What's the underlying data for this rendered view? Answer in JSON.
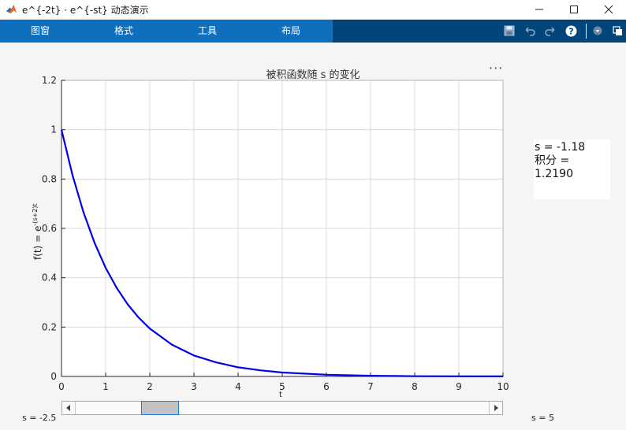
{
  "window": {
    "title": "e^{-2t} · e^{-st} 动态演示",
    "controls": [
      "minimize-icon",
      "maximize-icon",
      "close-icon"
    ]
  },
  "menu": {
    "items": [
      "图窗",
      "格式",
      "工具",
      "布局"
    ]
  },
  "toolbar": {
    "icons": [
      "save-icon",
      "undo-icon",
      "redo-icon",
      "help-icon",
      "dropdown-icon",
      "undock-icon"
    ]
  },
  "plot": {
    "title": "被积函数随 s 的变化",
    "ylabel_prefix": "f(t) = e",
    "ylabel_exponent": "-(s+2)t",
    "xlabel": "t",
    "more_menu": "···"
  },
  "info": {
    "line1": "s = -1.18",
    "line2": "积分 =",
    "line3": "1.2190"
  },
  "slider": {
    "min_label": "s = -2.5",
    "max_label": "s = 5",
    "min": -2.5,
    "max": 5,
    "value": -1.18
  },
  "colors": {
    "curve": "#0000e6",
    "menu_bar": "#0f6fbf",
    "toolstrip": "#00467a",
    "slider_thumb_border": "#1f7fd8"
  },
  "chart_data": {
    "type": "line",
    "title": "被积函数随 s 的变化",
    "xlabel": "t",
    "ylabel": "f(t) = e^{-(s+2)t}",
    "xlim": [
      0,
      10
    ],
    "ylim": [
      0,
      1.2
    ],
    "xticks": [
      0,
      1,
      2,
      3,
      4,
      5,
      6,
      7,
      8,
      9,
      10
    ],
    "yticks": [
      0,
      0.2,
      0.4,
      0.6,
      0.8,
      1,
      1.2
    ],
    "grid": true,
    "series": [
      {
        "x": [
          0,
          0.25,
          0.5,
          0.75,
          1,
          1.25,
          1.5,
          1.75,
          2,
          2.5,
          3,
          3.5,
          4,
          4.5,
          5,
          6,
          7,
          8,
          9,
          10
        ],
        "values": [
          1,
          0.815,
          0.664,
          0.541,
          0.44,
          0.359,
          0.292,
          0.238,
          0.194,
          0.129,
          0.085,
          0.057,
          0.037,
          0.025,
          0.016,
          0.007,
          0.003,
          0.001,
          0.0006,
          0.0003
        ]
      }
    ]
  }
}
